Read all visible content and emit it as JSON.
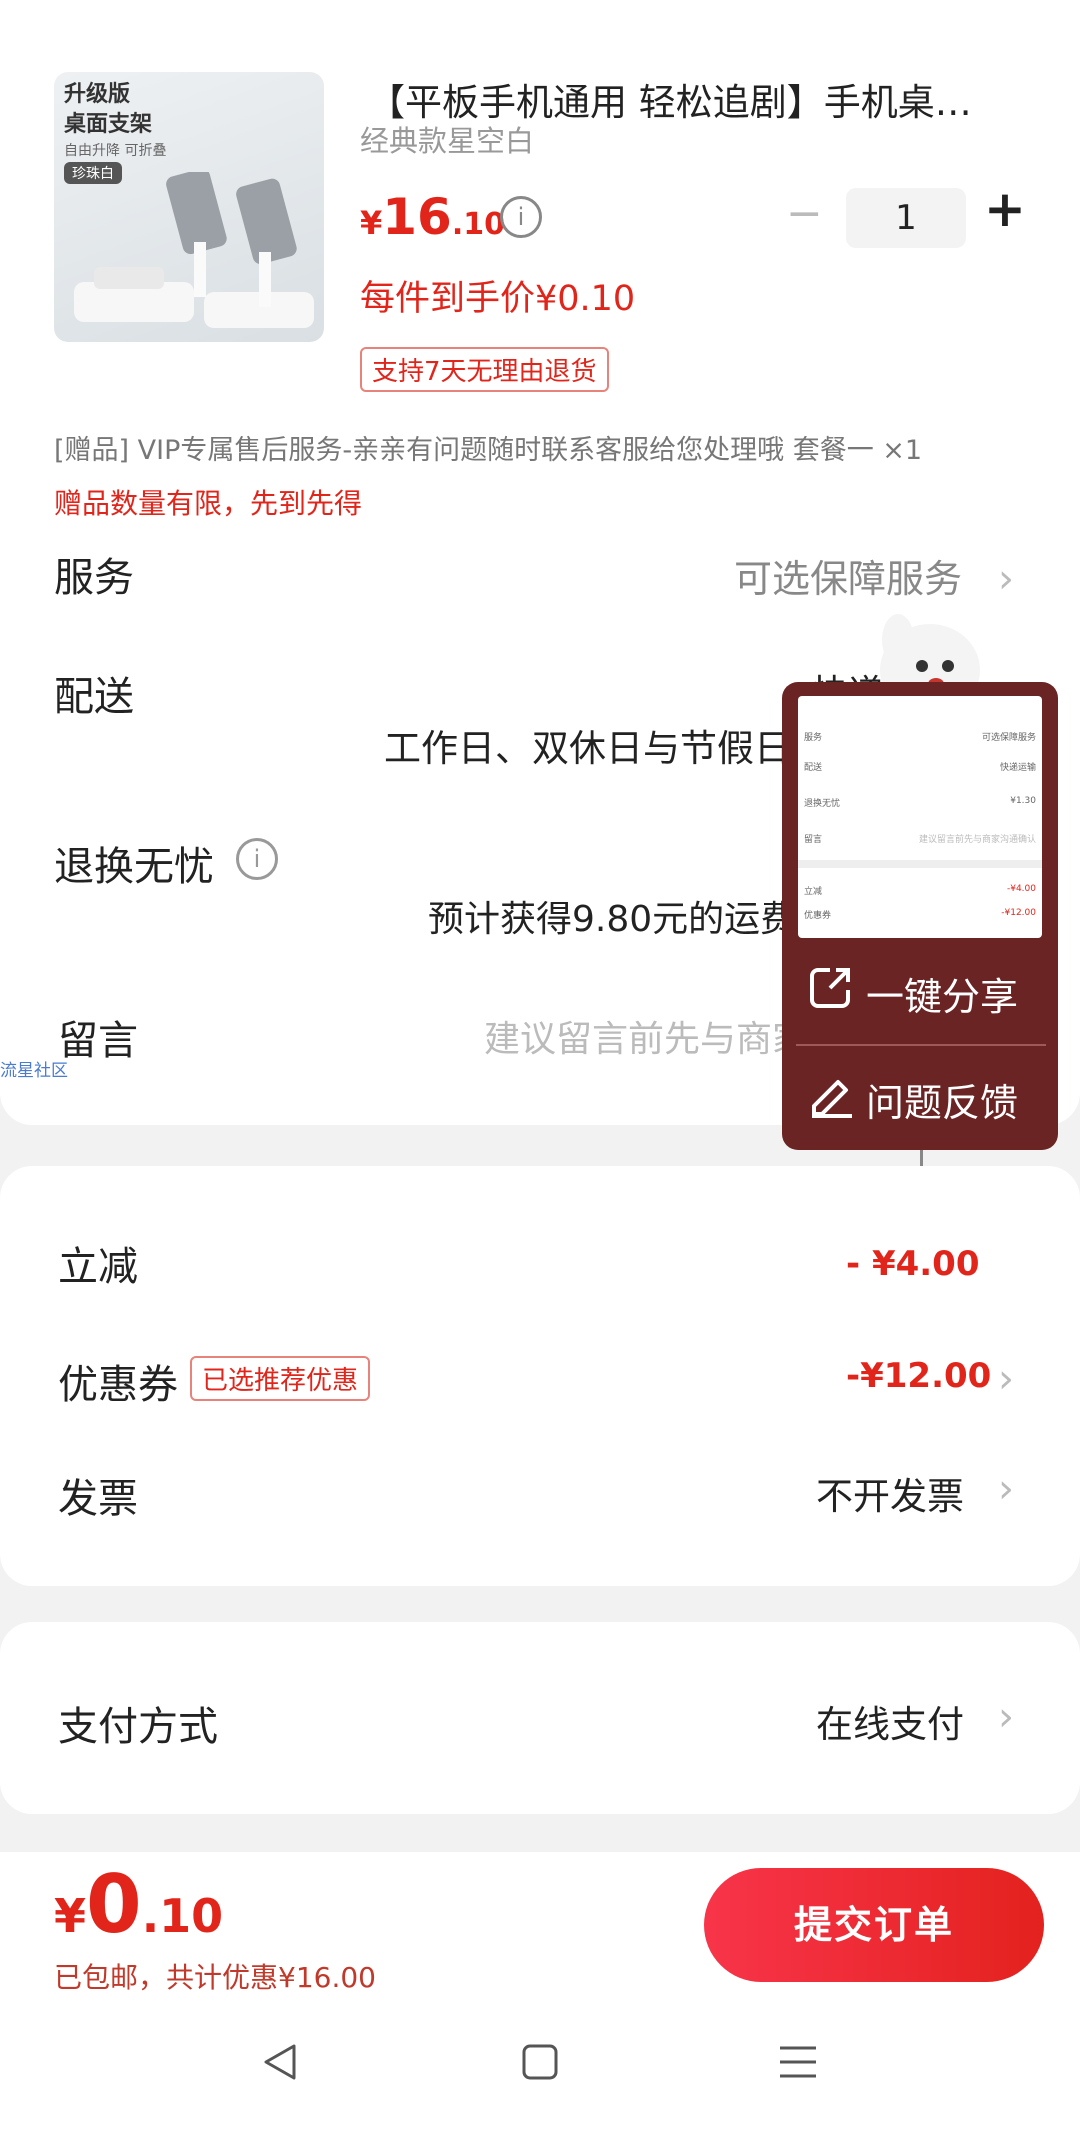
{
  "product": {
    "image_badge": "珍珠白",
    "image_title": "升级版\n桌面支架",
    "image_sub": "自由升降 可折叠",
    "title": "【平板手机通用 轻松追剧】手机桌…",
    "variant": "经典款星空白",
    "price_int": "16",
    "price_dec": ".10",
    "currency": "¥",
    "unit_price_text": "每件到手价¥0.10",
    "return_tag": "支持7天无理由退货",
    "quantity": "1",
    "minus": "−",
    "plus": "+"
  },
  "gift": {
    "text": "[赠品]  VIP专属售后服务-亲亲有问题随时联系客服给您处理哦 套餐一 ×1",
    "notice": "赠品数量有限，先到先得"
  },
  "rows": {
    "service_label": "服务",
    "service_value": "可选保障服务",
    "delivery_label": "配送",
    "delivery_value": "快递运输",
    "delivery_sub": "工作日、双休日与节假日",
    "return_label": "退换无忧",
    "return_sub": "预计获得9.80元的运费",
    "message_label": "留言",
    "message_placeholder": "建议留言前先与商家沟通确认"
  },
  "side_tag": "流星社区",
  "float_panel": {
    "share_label": "一键分享",
    "feedback_label": "问题反馈",
    "thumb_rows": [
      [
        "服务",
        "可选保障服务"
      ],
      [
        "配送",
        "快递运输"
      ],
      [
        "退换无忧",
        "¥1.30"
      ],
      [
        "留言",
        "建议留言前先与商家沟通确认"
      ],
      [
        "立减",
        "-¥4.00"
      ],
      [
        "优惠券",
        "-¥12.00"
      ]
    ]
  },
  "discounts": {
    "instant_label": "立减",
    "instant_value": "- ¥4.00",
    "coupon_label": "优惠券",
    "coupon_tag": "已选推荐优惠",
    "coupon_value": "-¥12.00",
    "invoice_label": "发票",
    "invoice_value": "不开发票"
  },
  "payment": {
    "label": "支付方式",
    "value": "在线支付"
  },
  "footer": {
    "currency": "¥",
    "total_int": "0",
    "total_dec": ".10",
    "summary": "已包邮，共计优惠¥16.00",
    "submit_label": "提交订单"
  },
  "nav": {
    "back_icon": "triangle-left",
    "home_icon": "square",
    "menu_icon": "three-lines"
  },
  "colors": {
    "accent": "#e1251b",
    "panel": "#6b2424",
    "submit_gradient_start": "#f8344a",
    "submit_gradient_end": "#e3221e"
  }
}
